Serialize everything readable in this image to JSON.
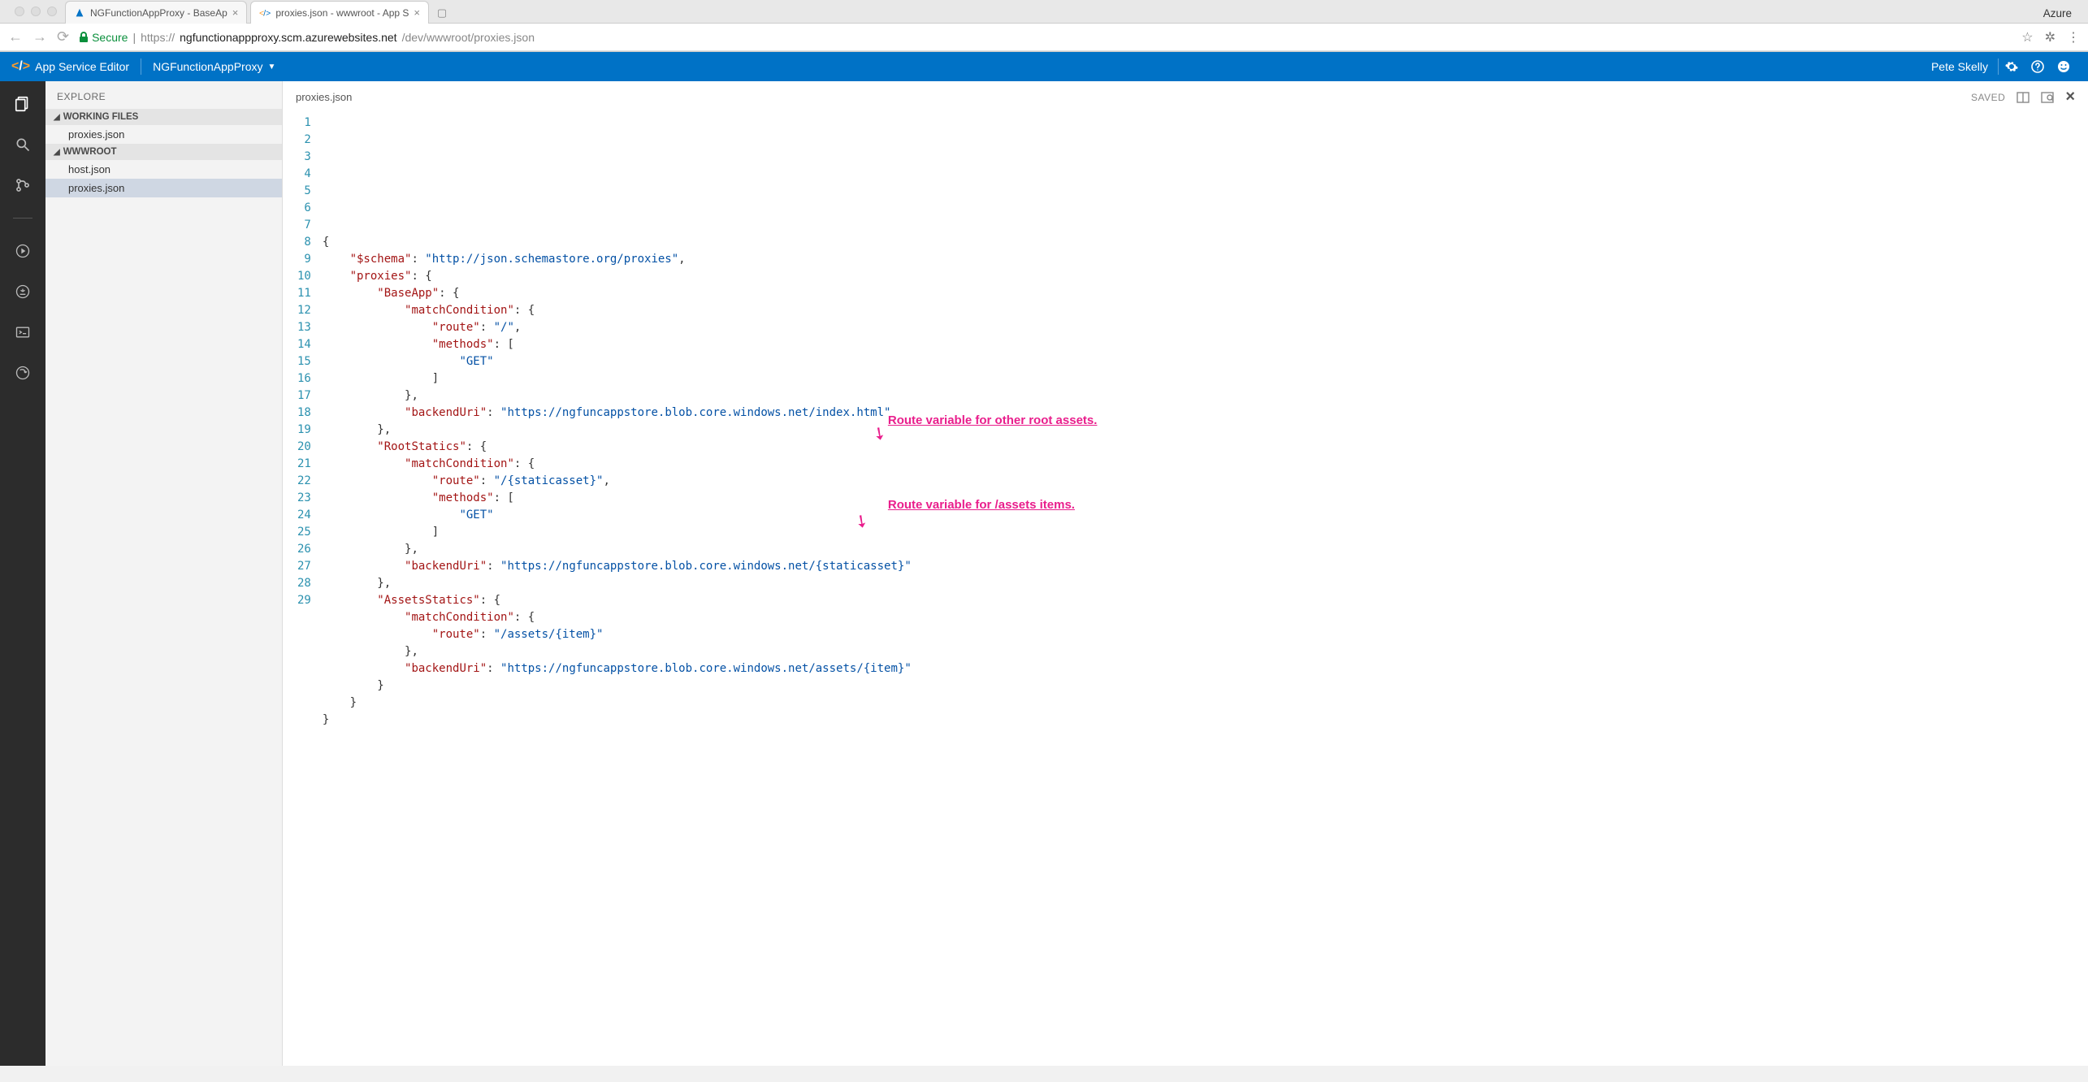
{
  "browser": {
    "tabs": [
      {
        "title": "NGFunctionAppProxy - BaseAp",
        "favicon": "azure"
      },
      {
        "title": "proxies.json - wwwroot - App S",
        "favicon": "code"
      }
    ],
    "profile_label": "Azure",
    "secure_label": "Secure",
    "url_scheme": "https://",
    "url_host": "ngfunctionappproxy.scm.azurewebsites.net",
    "url_path": "/dev/wwwroot/proxies.json"
  },
  "header": {
    "brand": "App Service Editor",
    "app_name": "NGFunctionAppProxy",
    "user": "Pete Skelly"
  },
  "sidebar": {
    "title": "EXPLORE",
    "sections": {
      "working": {
        "label": "WORKING FILES",
        "items": [
          "proxies.json"
        ]
      },
      "root": {
        "label": "WWWROOT",
        "items": [
          "host.json",
          "proxies.json"
        ]
      }
    }
  },
  "editor": {
    "filename": "proxies.json",
    "saved_label": "SAVED",
    "close": "×"
  },
  "code": {
    "lines": [
      [
        [
          "punc",
          "{"
        ]
      ],
      [
        [
          "indent",
          "    "
        ],
        [
          "key",
          "\"$schema\""
        ],
        [
          "punc",
          ": "
        ],
        [
          "str",
          "\"http://json.schemastore.org/proxies\""
        ],
        [
          "punc",
          ","
        ]
      ],
      [
        [
          "indent",
          "    "
        ],
        [
          "key",
          "\"proxies\""
        ],
        [
          "punc",
          ": {"
        ]
      ],
      [
        [
          "indent",
          "        "
        ],
        [
          "key",
          "\"BaseApp\""
        ],
        [
          "punc",
          ": {"
        ]
      ],
      [
        [
          "indent",
          "            "
        ],
        [
          "key",
          "\"matchCondition\""
        ],
        [
          "punc",
          ": {"
        ]
      ],
      [
        [
          "indent",
          "                "
        ],
        [
          "key",
          "\"route\""
        ],
        [
          "punc",
          ": "
        ],
        [
          "str",
          "\"/\""
        ],
        [
          "punc",
          ","
        ]
      ],
      [
        [
          "indent",
          "                "
        ],
        [
          "key",
          "\"methods\""
        ],
        [
          "punc",
          ": ["
        ]
      ],
      [
        [
          "indent",
          "                    "
        ],
        [
          "str",
          "\"GET\""
        ]
      ],
      [
        [
          "indent",
          "                "
        ],
        [
          "punc",
          "]"
        ]
      ],
      [
        [
          "indent",
          "            "
        ],
        [
          "punc",
          "},"
        ]
      ],
      [
        [
          "indent",
          "            "
        ],
        [
          "key",
          "\"backendUri\""
        ],
        [
          "punc",
          ": "
        ],
        [
          "str",
          "\"https://ngfuncappstore.blob.core.windows.net/index.html\""
        ]
      ],
      [
        [
          "indent",
          "        "
        ],
        [
          "punc",
          "},"
        ]
      ],
      [
        [
          "indent",
          "        "
        ],
        [
          "key",
          "\"RootStatics\""
        ],
        [
          "punc",
          ": {"
        ]
      ],
      [
        [
          "indent",
          "            "
        ],
        [
          "key",
          "\"matchCondition\""
        ],
        [
          "punc",
          ": {"
        ]
      ],
      [
        [
          "indent",
          "                "
        ],
        [
          "key",
          "\"route\""
        ],
        [
          "punc",
          ": "
        ],
        [
          "str",
          "\"/{staticasset}\""
        ],
        [
          "punc",
          ","
        ]
      ],
      [
        [
          "indent",
          "                "
        ],
        [
          "key",
          "\"methods\""
        ],
        [
          "punc",
          ": ["
        ]
      ],
      [
        [
          "indent",
          "                    "
        ],
        [
          "str",
          "\"GET\""
        ]
      ],
      [
        [
          "indent",
          "                "
        ],
        [
          "punc",
          "]"
        ]
      ],
      [
        [
          "indent",
          "            "
        ],
        [
          "punc",
          "},"
        ]
      ],
      [
        [
          "indent",
          "            "
        ],
        [
          "key",
          "\"backendUri\""
        ],
        [
          "punc",
          ": "
        ],
        [
          "str",
          "\"https://ngfuncappstore.blob.core.windows.net/{staticasset}\""
        ]
      ],
      [
        [
          "indent",
          "        "
        ],
        [
          "punc",
          "},"
        ]
      ],
      [
        [
          "indent",
          "        "
        ],
        [
          "key",
          "\"AssetsStatics\""
        ],
        [
          "punc",
          ": {"
        ]
      ],
      [
        [
          "indent",
          "            "
        ],
        [
          "key",
          "\"matchCondition\""
        ],
        [
          "punc",
          ": {"
        ]
      ],
      [
        [
          "indent",
          "                "
        ],
        [
          "key",
          "\"route\""
        ],
        [
          "punc",
          ": "
        ],
        [
          "str",
          "\"/assets/{item}\""
        ]
      ],
      [
        [
          "indent",
          "            "
        ],
        [
          "punc",
          "},"
        ]
      ],
      [
        [
          "indent",
          "            "
        ],
        [
          "key",
          "\"backendUri\""
        ],
        [
          "punc",
          ": "
        ],
        [
          "str",
          "\"https://ngfuncappstore.blob.core.windows.net/assets/{item}\""
        ]
      ],
      [
        [
          "indent",
          "        "
        ],
        [
          "punc",
          "}"
        ]
      ],
      [
        [
          "indent",
          "    "
        ],
        [
          "punc",
          "}"
        ]
      ],
      [
        [
          "punc",
          "}"
        ]
      ]
    ]
  },
  "annotations": {
    "a1": "Route variable for other root assets.",
    "a2": "Route variable for /assets items."
  }
}
